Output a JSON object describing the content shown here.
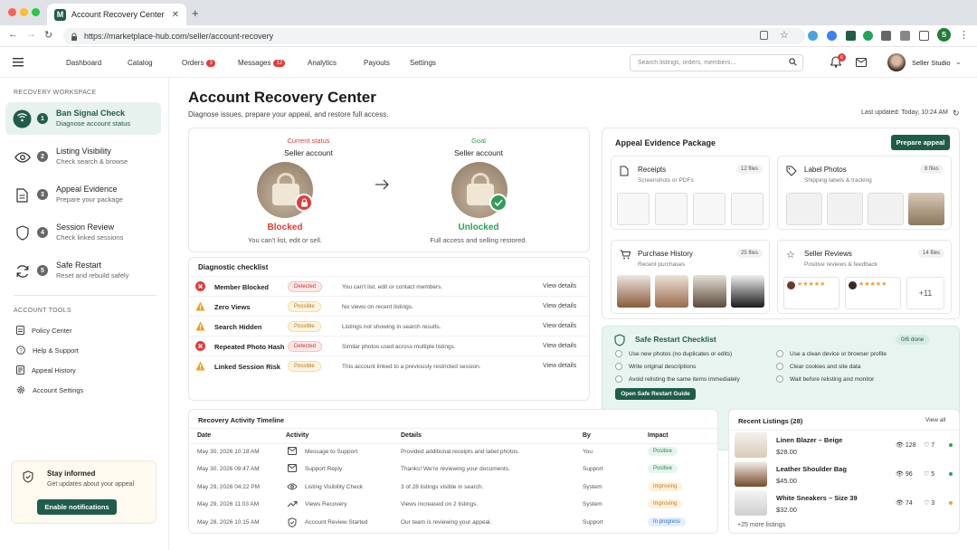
{
  "browser": {
    "tab_title": "Account Recovery Center",
    "url": "https://marketplace-hub.com/seller/account-recovery",
    "profile_initial": "S",
    "favicon_letter": "M"
  },
  "topnav": {
    "items": [
      {
        "label": "Dashboard"
      },
      {
        "label": "Catalog"
      },
      {
        "label": "Orders",
        "badge": "3"
      },
      {
        "label": "Messages",
        "badge": "12"
      },
      {
        "label": "Analytics"
      },
      {
        "label": "Payouts"
      },
      {
        "label": "Settings"
      }
    ],
    "search_placeholder": "Search listings, orders, members...",
    "notif_count": "6",
    "account_name": "Seller Studio"
  },
  "sidebar": {
    "workspace_title": "RECOVERY WORKSPACE",
    "steps": [
      {
        "num": "1",
        "title": "Ban Signal Check",
        "sub": "Diagnose account status"
      },
      {
        "num": "2",
        "title": "Listing Visibility",
        "sub": "Check search & browse"
      },
      {
        "num": "3",
        "title": "Appeal Evidence",
        "sub": "Prepare your package"
      },
      {
        "num": "4",
        "title": "Session Review",
        "sub": "Check linked sessions"
      },
      {
        "num": "5",
        "title": "Safe Restart",
        "sub": "Reset and rebuild safely"
      }
    ],
    "tools_title": "ACCOUNT TOOLS",
    "tools": [
      {
        "label": "Policy Center"
      },
      {
        "label": "Help & Support"
      },
      {
        "label": "Appeal History"
      },
      {
        "label": "Account Settings"
      }
    ],
    "inform": {
      "title": "Stay informed",
      "sub": "Get updates about your appeal",
      "button": "Enable notifications"
    }
  },
  "page": {
    "title": "Account Recovery Center",
    "subtitle": "Diagnose issues, prepare your appeal, and restore full access.",
    "last_updated": "Last updated: Today, 10:24 AM"
  },
  "status": {
    "current_label": "Current status",
    "current_heading": "Seller account",
    "current_state": "Blocked",
    "current_desc": "You can't list, edit or sell.",
    "goal_label": "Goal",
    "goal_heading": "Seller account",
    "goal_state": "Unlocked",
    "goal_desc": "Full access and selling restored.",
    "red": "#e23b3b",
    "green": "#2f9e58"
  },
  "checklist": {
    "title": "Diagnostic checklist",
    "rows": [
      {
        "name": "Member Blocked",
        "status": "Detected",
        "desc": "You can't list, edit or contact members.",
        "link": "View details"
      },
      {
        "name": "Zero Views",
        "status": "Possible",
        "desc": "No views on recent listings.",
        "link": "View details"
      },
      {
        "name": "Search Hidden",
        "status": "Possible",
        "desc": "Listings not showing in search results.",
        "link": "View details"
      },
      {
        "name": "Repeated Photo Hash",
        "status": "Detected",
        "desc": "Similar photos used across multiple listings.",
        "link": "View details"
      },
      {
        "name": "Linked Session Risk",
        "status": "Possible",
        "desc": "This account linked to a previously restricted session.",
        "link": "View details"
      }
    ]
  },
  "evidence": {
    "title": "Appeal Evidence Package",
    "button": "Prepare appeal",
    "cards": [
      {
        "title": "Receipts",
        "sub": "Screenshots or PDFs",
        "count": "12 files"
      },
      {
        "title": "Label Photos",
        "sub": "Shipping labels & tracking",
        "count": "8 files"
      },
      {
        "title": "Purchase History",
        "sub": "Recent purchases",
        "count": "25 files"
      },
      {
        "title": "Seller Reviews",
        "sub": "Positive reviews & feedback",
        "count": "14 files"
      }
    ],
    "more_reviews": "+11",
    "stars": "★★★★★"
  },
  "safe_restart": {
    "title": "Safe Restart Checklist",
    "progress": "0/6 done",
    "items_left": [
      "Use new photos (no duplicates or edits)",
      "Write original descriptions",
      "Avoid relisting the same items immediately"
    ],
    "items_right": [
      "Use a clean device or browser profile",
      "Clear cookies and site data",
      "Wait before relisting and monitor"
    ],
    "button": "Open Safe Restart Guide"
  },
  "timeline": {
    "title": "Recovery Activity Timeline",
    "headers": [
      "Date",
      "Activity",
      "Details",
      "By",
      "Impact"
    ],
    "rows": [
      {
        "date": "May 30, 2026 10:18 AM",
        "activity": "Message to Support",
        "details": "Provided additional receipts and label photos.",
        "by": "You",
        "impact": "Positive"
      },
      {
        "date": "May 30, 2026 09:47 AM",
        "activity": "Support Reply",
        "details": "Thanks! We're reviewing your documents.",
        "by": "Support",
        "impact": "Positive"
      },
      {
        "date": "May 29, 2026 04:22 PM",
        "activity": "Listing Visibility Check",
        "details": "3 of 28 listings visible in search.",
        "by": "System",
        "impact": "Improving"
      },
      {
        "date": "May 29, 2026 11:03 AM",
        "activity": "Views Recovery",
        "details": "Views increased on 2 listings.",
        "by": "System",
        "impact": "Improving"
      },
      {
        "date": "May 28, 2026 10:15 AM",
        "activity": "Account Review Started",
        "details": "Our team is reviewing your appeal.",
        "by": "Support",
        "impact": "In progress"
      }
    ]
  },
  "listings": {
    "title": "Recent Listings (28)",
    "view_all": "View all",
    "items": [
      {
        "name": "Linen Blazer – Beige",
        "price": "$28.00",
        "views": "128",
        "likes": "7",
        "dot": "#2f9e58"
      },
      {
        "name": "Leather Shoulder Bag",
        "price": "$45.00",
        "views": "96",
        "likes": "5",
        "dot": "#2f9e58"
      },
      {
        "name": "White Sneakers – Size 39",
        "price": "$32.00",
        "views": "74",
        "likes": "3",
        "dot": "#e8a33d"
      }
    ],
    "more": "+25 more listings"
  }
}
